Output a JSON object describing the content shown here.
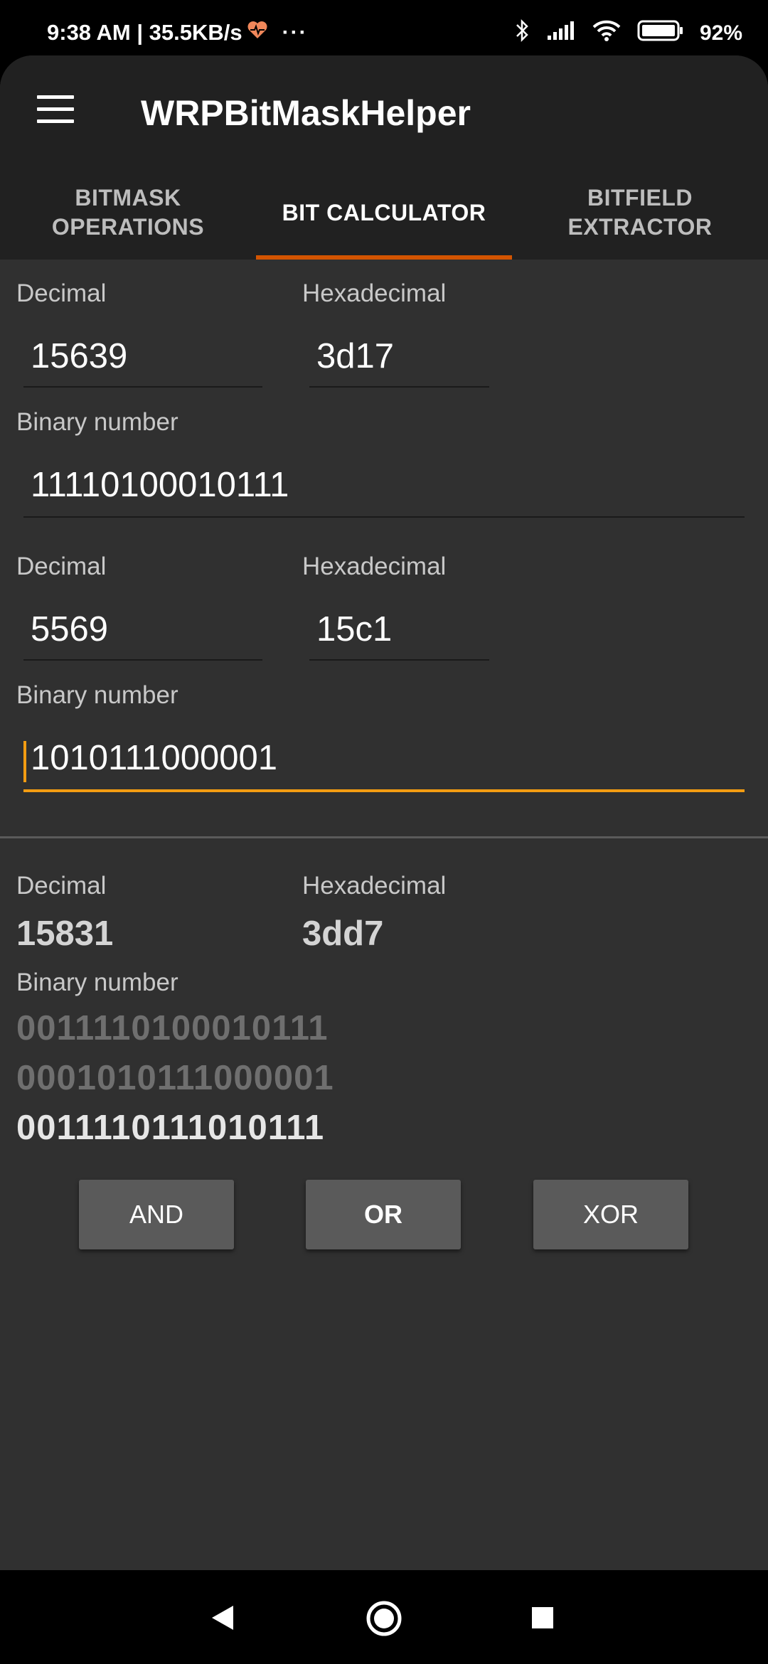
{
  "status": {
    "time_speed": "9:38 AM | 35.5KB/s",
    "dots": "···",
    "battery_percent": "92%",
    "icons": [
      "heart-icon",
      "bluetooth-icon",
      "signal-icon",
      "wifi-icon",
      "battery-icon"
    ]
  },
  "toolbar": {
    "title": "WRPBitMaskHelper",
    "menu_icon": "hamburger-menu-icon"
  },
  "tabs": [
    {
      "label": "BITMASK\nOPERATIONS",
      "active": false
    },
    {
      "label": "BIT CALCULATOR",
      "active": true
    },
    {
      "label": "BITFIELD\nEXTRACTOR",
      "active": false
    }
  ],
  "operand1": {
    "decimal_label": "Decimal",
    "decimal_value": "15639",
    "hex_label": "Hexadecimal",
    "hex_value": "3d17",
    "binary_label": "Binary number",
    "binary_value": "11110100010111"
  },
  "operand2": {
    "decimal_label": "Decimal",
    "decimal_value": "5569",
    "hex_label": "Hexadecimal",
    "hex_value": "15c1",
    "binary_label": "Binary number",
    "binary_value": "1010111000001"
  },
  "result": {
    "decimal_label": "Decimal",
    "decimal_value": "15831",
    "hex_label": "Hexadecimal",
    "hex_value": "3dd7",
    "binary_label": "Binary number",
    "binary_lines": [
      "0011110100010111",
      "0001010111000001",
      "0011110111010111"
    ]
  },
  "operations": {
    "and_label": "AND",
    "or_label": "OR",
    "xor_label": "XOR"
  },
  "colors": {
    "accent": "#f39c12",
    "tab_indicator": "#d35400",
    "background": "#303030",
    "toolbar": "#212121"
  },
  "nav": {
    "back_icon": "back-triangle-icon",
    "home_icon": "home-circle-icon",
    "recents_icon": "recents-square-icon"
  }
}
